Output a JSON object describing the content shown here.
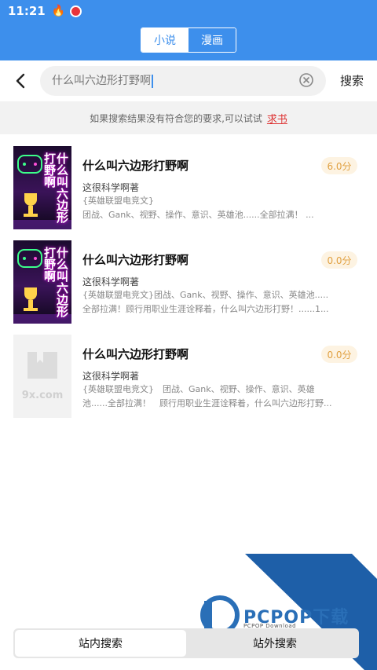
{
  "status_bar": {
    "time": "11:21",
    "icons": [
      "flame-icon",
      "notification-badge-icon"
    ]
  },
  "tabs": [
    {
      "label": "小说",
      "active": true
    },
    {
      "label": "漫画",
      "active": false
    }
  ],
  "search": {
    "query": "什么叫六边形打野啊",
    "button_label": "搜索"
  },
  "tip": {
    "text": "如果搜索结果没有符合您的要求,可以试试",
    "link_label": "求书"
  },
  "results": [
    {
      "title": "什么叫六边形打野啊",
      "author": "这很科学啊著",
      "desc_line1": "{英雄联盟电竞文}",
      "desc_line2": "团战、Gank、视野、操作、意识、英雄池......全部拉满！ ...",
      "score": "6.0分",
      "cover_text": "什么叫六边形打野啊"
    },
    {
      "title": "什么叫六边形打野啊",
      "author": "这很科学啊著",
      "desc_line1": "{英雄联盟电竞文}团战、Gank、视野、操作、意识、英雄池.....",
      "desc_line2": "全部拉满！顾行用职业生涯诠释着，什么叫六边形打野！......1...",
      "score": "0.0分",
      "cover_text": "什么叫六边形打野啊"
    },
    {
      "title": "什么叫六边形打野啊",
      "author": "这很科学啊著",
      "desc_line1": "{英雄联盟电竞文}　团战、Gank、视野、操作、意识、英雄",
      "desc_line2": "池......全部拉满！　顾行用职业生涯诠释着，什么叫六边形打野...",
      "score": "0.0分",
      "cover_text": "9x.com"
    }
  ],
  "bottom_tabs": {
    "inside_label": "站内搜索",
    "outside_label": "站外搜索"
  },
  "watermark": {
    "brand": "PCPOP下载",
    "sub": "PCPOP Download"
  },
  "colors": {
    "primary": "#3d8fec",
    "accent_link": "#dd3333",
    "score_text": "#e0a040"
  }
}
